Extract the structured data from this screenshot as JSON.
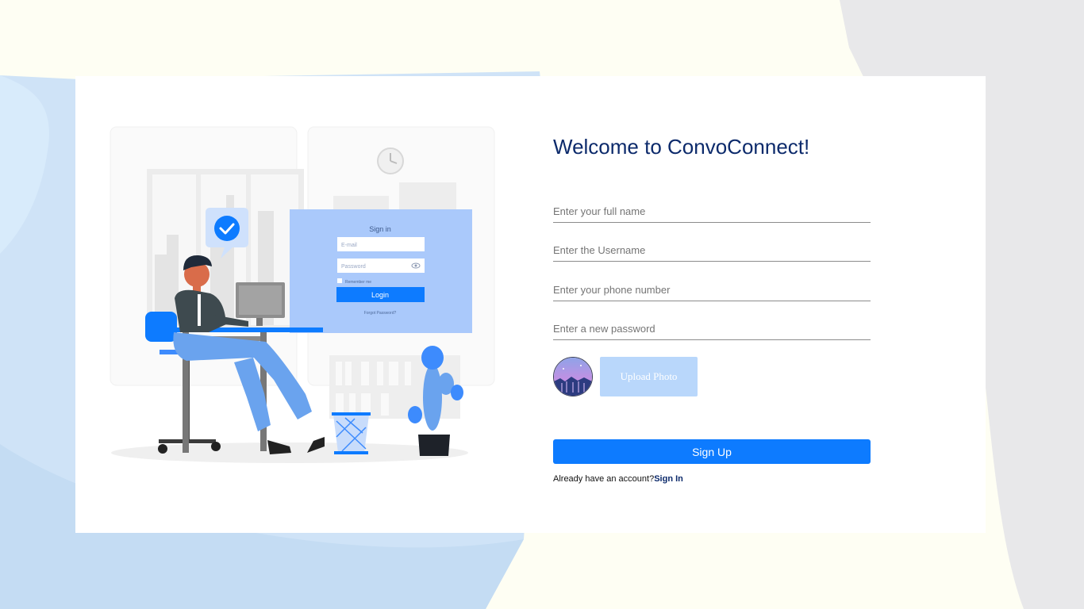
{
  "colors": {
    "page_background": "#fefef3",
    "card_background": "#ffffff",
    "title_color": "#0c2a6b",
    "primary_button": "#0d7bff",
    "upload_button": "#b9d7fb",
    "illustration_accent": "#3d8bfd"
  },
  "illustration": {
    "mock_title": "Sign in",
    "mock_email_placeholder": "E-mail",
    "mock_password_placeholder": "Password",
    "mock_remember": "Remember me",
    "mock_login_button": "Login",
    "mock_forgot": "Forgot Password?",
    "check_icon": "check-circle-icon",
    "eye_icon": "eye-icon"
  },
  "form": {
    "title": "Welcome to ConvoConnect!",
    "fields": {
      "full_name_placeholder": "Enter your full name",
      "username_placeholder": "Enter the Username",
      "phone_placeholder": "Enter your phone number",
      "password_placeholder": "Enter a new password"
    },
    "upload_button": "Upload Photo",
    "signup_button": "Sign Up",
    "account_prompt": "Already have an account?",
    "signin_link": "Sign In"
  }
}
